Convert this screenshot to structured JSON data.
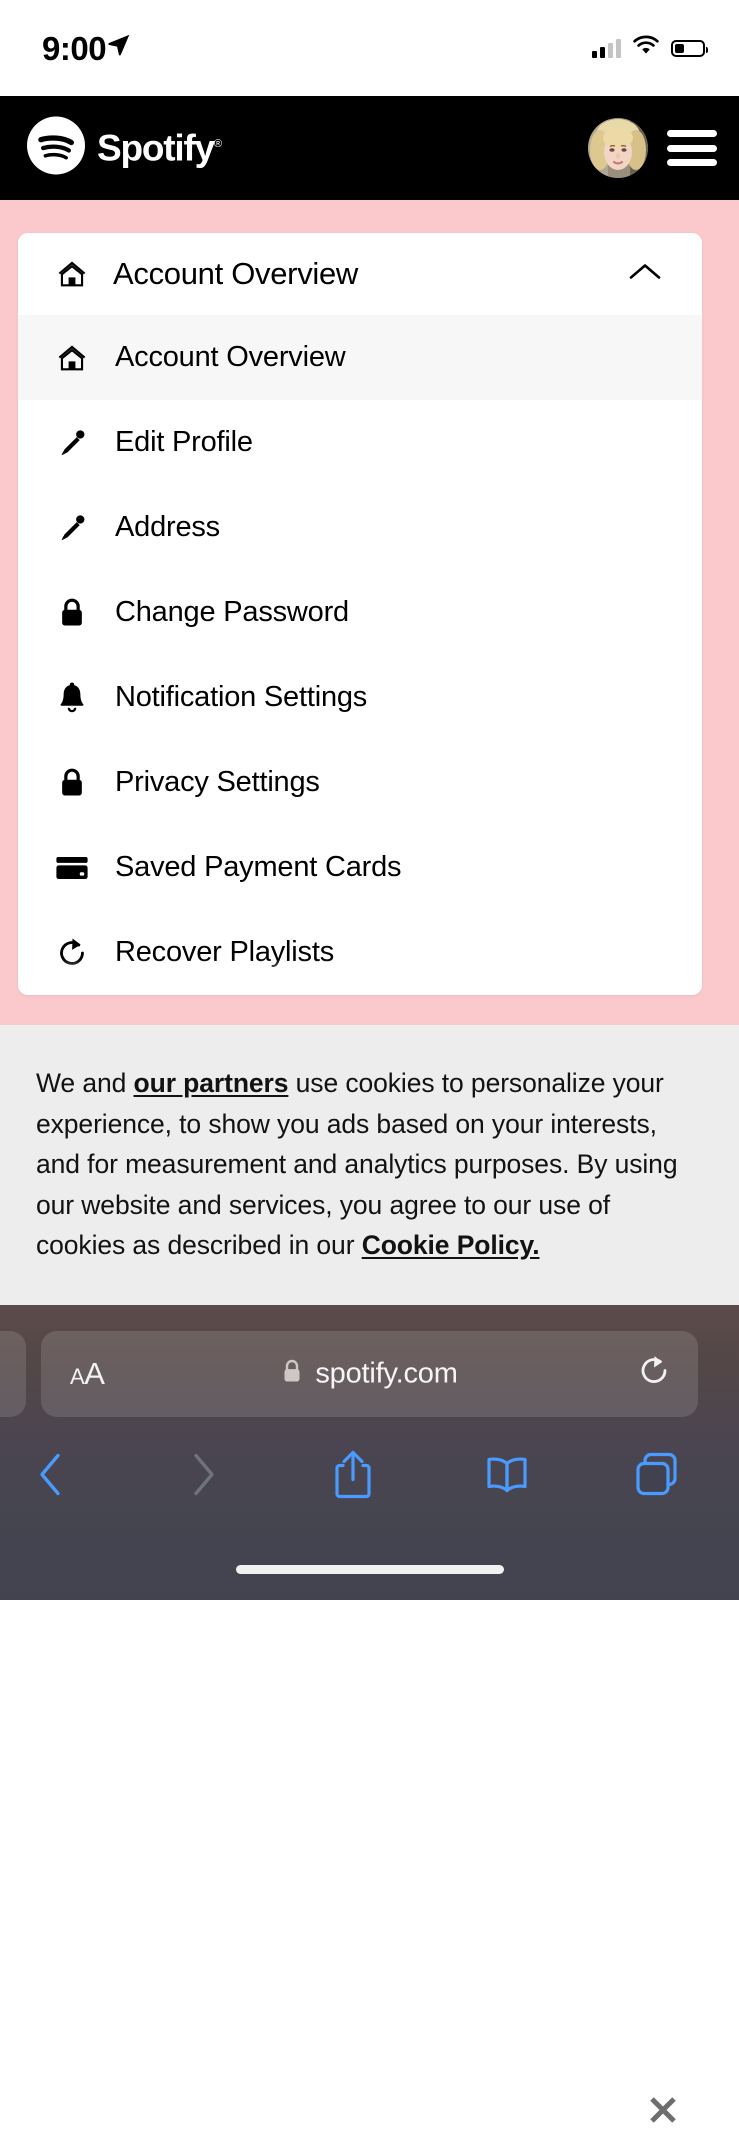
{
  "status_bar": {
    "time": "9:00",
    "location_icon": "location-arrow-icon",
    "cellular_icon": "cellular-bars-icon",
    "cellular_bars_filled": 2,
    "cellular_bars_total": 4,
    "wifi_icon": "wifi-icon",
    "battery_icon": "battery-icon",
    "battery_percent": 30
  },
  "site_header": {
    "brand": "Spotify",
    "brand_trademark": "®",
    "logo_icon": "spotify-logo-icon",
    "avatar_icon": "user-avatar",
    "menu_icon": "hamburger-menu-icon",
    "background_color": "#000000"
  },
  "page": {
    "background_color": "#FBC9CC"
  },
  "account_menu": {
    "header": {
      "label": "Account Overview",
      "icon": "home-icon",
      "expanded": true,
      "chevron_icon": "chevron-up-icon"
    },
    "items": [
      {
        "label": "Account Overview",
        "icon": "home-icon",
        "selected": true
      },
      {
        "label": "Edit Profile",
        "icon": "pencil-icon",
        "selected": false
      },
      {
        "label": "Address",
        "icon": "pencil-icon",
        "selected": false
      },
      {
        "label": "Change Password",
        "icon": "lock-icon",
        "selected": false
      },
      {
        "label": "Notification Settings",
        "icon": "bell-icon",
        "selected": false
      },
      {
        "label": "Privacy Settings",
        "icon": "lock-icon",
        "selected": false
      },
      {
        "label": "Saved Payment Cards",
        "icon": "credit-card-icon",
        "selected": false
      },
      {
        "label": "Recover Playlists",
        "icon": "refresh-icon",
        "selected": false
      }
    ],
    "selected_background_color": "#F7F7F8"
  },
  "cookie_banner": {
    "text_1": "We and ",
    "link_partners": "our partners",
    "text_2": " use cookies to personalize your experience, to show you ads based on your interests, and for measurement and analytics purposes. By using our website and services, you agree to our use of cookies as described in our ",
    "link_policy": "Cookie Policy.",
    "close_icon": "close-x-icon",
    "background_color": "#EDEDED"
  },
  "browser": {
    "text_size_small": "A",
    "text_size_large": "A",
    "text_size_button_name": "AA",
    "lock_icon": "lock-icon",
    "url": "spotify.com",
    "reload_icon": "reload-icon",
    "toolbar": {
      "back_icon": "chevron-left-icon",
      "forward_icon": "chevron-right-icon",
      "share_icon": "share-icon",
      "bookmarks_icon": "book-icon",
      "tabs_icon": "tabs-icon",
      "back_enabled": true,
      "forward_enabled": false,
      "accent_color": "#4a9bff"
    },
    "home_indicator": "home-indicator"
  }
}
